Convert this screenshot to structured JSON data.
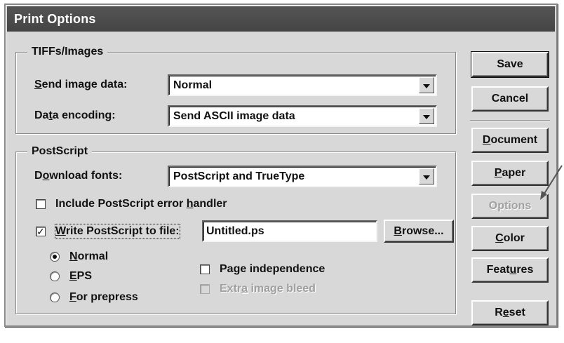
{
  "window": {
    "title": "Print Options"
  },
  "tiffs": {
    "title": "TIFFs/Images",
    "send_label": "Send image data:",
    "send_value": "Normal",
    "encoding_label": "Data encoding:",
    "encoding_value": "Send ASCII image data"
  },
  "postscript": {
    "title": "PostScript",
    "fonts_label": "Download fonts:",
    "fonts_value": "PostScript and TrueType",
    "error_handler_label": "Include PostScript error handler",
    "write_label": "Write PostScript to file:",
    "file_value": "Untitled.ps",
    "browse_label": "Browse...",
    "radio_normal": "Normal",
    "radio_eps": "EPS",
    "radio_prepress": "For prepress",
    "page_independence": "Page independence",
    "extra_bleed": "Extra image bleed"
  },
  "buttons": {
    "save": "Save",
    "cancel": "Cancel",
    "document": "Document",
    "paper": "Paper",
    "options": "Options",
    "color": "Color",
    "features": "Features",
    "reset": "Reset"
  }
}
